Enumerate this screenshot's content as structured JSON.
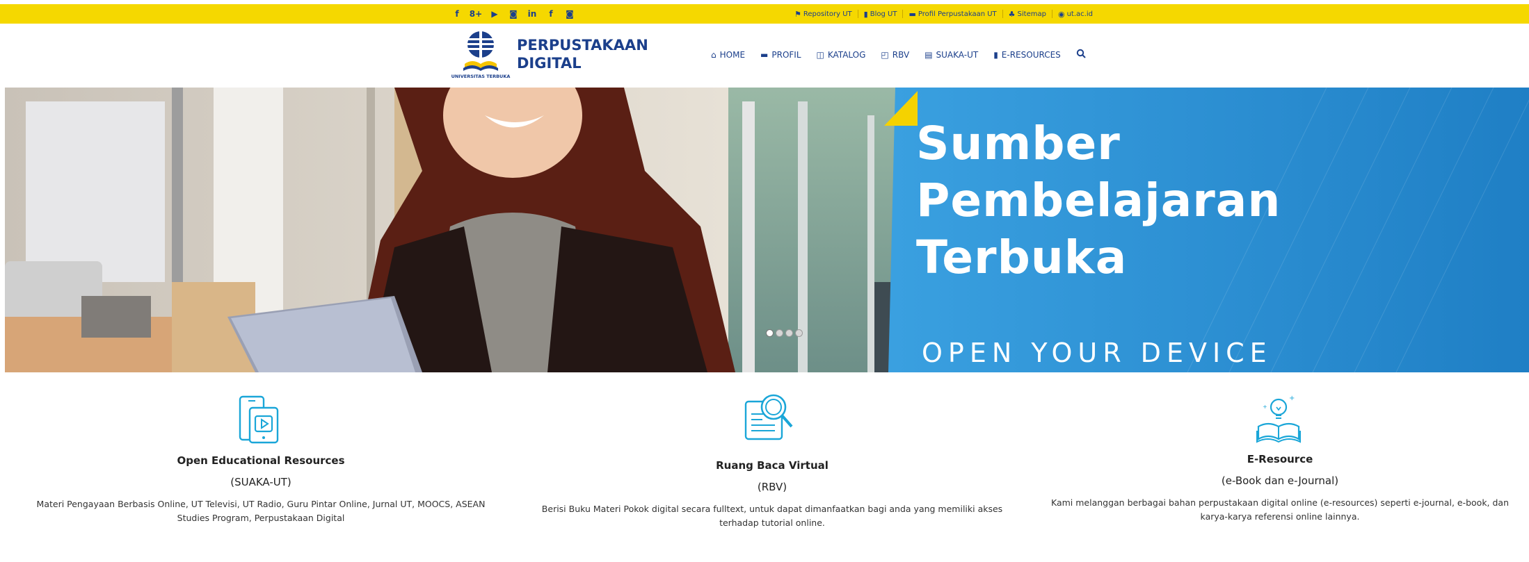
{
  "topbar": {
    "social": [
      "f",
      "8+",
      "▶",
      "◙",
      "in",
      "f",
      "◙"
    ],
    "links": [
      {
        "icon": "flag-icon",
        "glyph": "⚑",
        "label": "Repository UT"
      },
      {
        "icon": "book-icon",
        "glyph": "▮",
        "label": "Blog UT"
      },
      {
        "icon": "book-open-icon",
        "glyph": "▬",
        "label": "Profil Perpustakaan UT"
      },
      {
        "icon": "sitemap-icon",
        "glyph": "♣",
        "label": "Sitemap"
      },
      {
        "icon": "globe-icon",
        "glyph": "◉",
        "label": "ut.ac.id"
      }
    ]
  },
  "header": {
    "logo_caption": "UNIVERSITAS TERBUKA",
    "brand_line1": "PERPUSTAKAAN",
    "brand_line2": "DIGITAL",
    "nav": [
      {
        "icon": "home-icon",
        "glyph": "⌂",
        "label": "HOME"
      },
      {
        "icon": "profile-icon",
        "glyph": "▬",
        "label": "PROFIL"
      },
      {
        "icon": "catalog-icon",
        "glyph": "◫",
        "label": "KATALOG"
      },
      {
        "icon": "rbv-icon",
        "glyph": "◰",
        "label": "RBV"
      },
      {
        "icon": "suaka-icon",
        "glyph": "▤",
        "label": "SUAKA-UT"
      },
      {
        "icon": "eresources-icon",
        "glyph": "▮",
        "label": "E-RESOURCES"
      }
    ]
  },
  "hero": {
    "title_line1": "Sumber",
    "title_line2": "Pembelajaran",
    "title_line3": "Terbuka",
    "subtitle": "OPEN YOUR DEVICE",
    "slide_count": 4,
    "active_slide": 1
  },
  "features": [
    {
      "icon": "tablet-video-icon",
      "title": "Open Educational Resources",
      "subtitle": "(SUAKA-UT)",
      "description": "Materi Pengayaan Berbasis Online, UT Televisi, UT Radio, Guru Pintar Online, Jurnal UT, MOOCS, ASEAN Studies Program, Perpustakaan Digital"
    },
    {
      "icon": "document-search-icon",
      "title": "Ruang Baca Virtual",
      "subtitle": "(RBV)",
      "description": "Berisi Buku Materi Pokok digital secara fulltext, untuk dapat dimanfaatkan bagi anda yang memiliki akses terhadap tutorial online."
    },
    {
      "icon": "book-idea-icon",
      "title": "E-Resource",
      "subtitle": "(e-Book dan e-Journal)",
      "description": "Kami melanggan berbagai bahan perpustakaan digital online (e-resources) seperti e-journal, e-book, dan karya-karya referensi online lainnya."
    }
  ],
  "colors": {
    "topbar": "#f5d800",
    "brand_blue": "#1b3f8b",
    "icon_blue": "#1aa6d8",
    "hero_blue": "#2f8fd4"
  }
}
